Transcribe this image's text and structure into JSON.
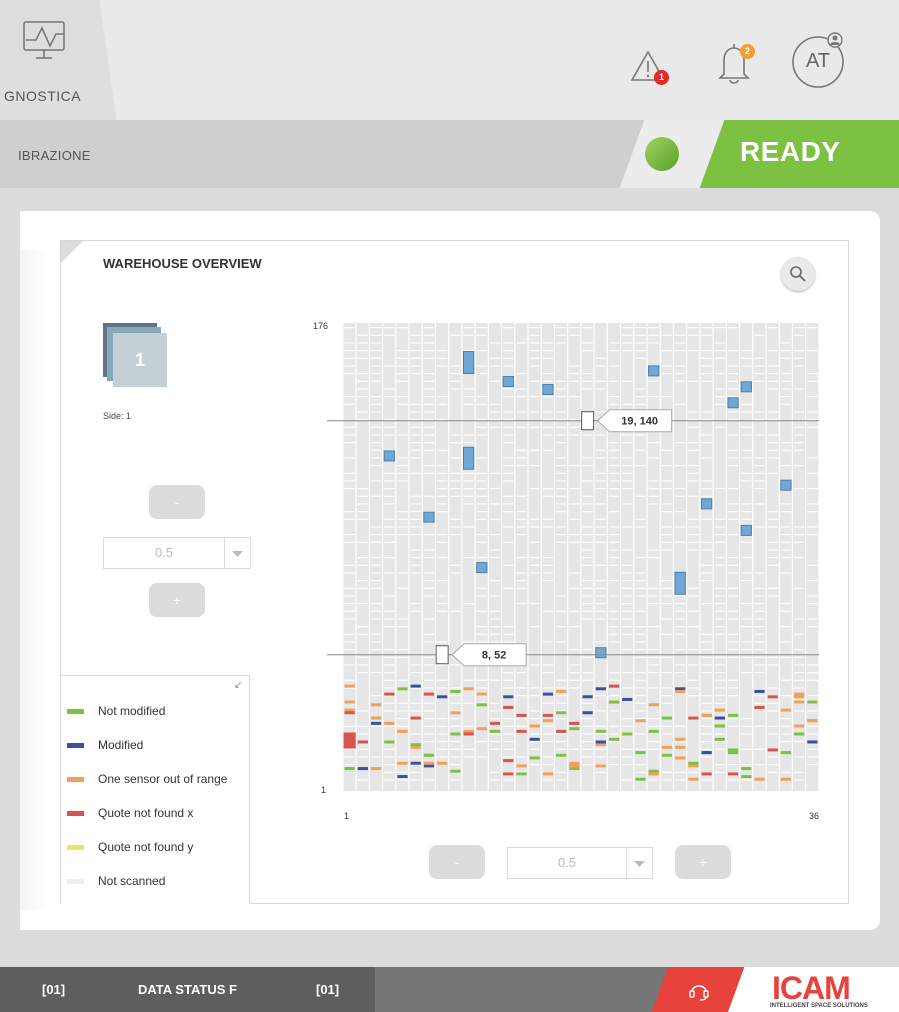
{
  "topbar": {
    "diagnostics_label": "GNOSTICA",
    "alerts_count": "1",
    "notifications_count": "2",
    "user_initials": "AT"
  },
  "subbar": {
    "label": "IBRAZIONE",
    "status": "READY"
  },
  "panel": {
    "title": "WAREHOUSE OVERVIEW",
    "side_number": "1",
    "side_label": "Side: 1",
    "left_zoom": {
      "minus": "-",
      "value": "0.5",
      "plus": "+"
    },
    "bottom_zoom": {
      "minus": "-",
      "value": "0.5",
      "plus": "+"
    }
  },
  "legend": {
    "items": [
      {
        "label": "Not modified",
        "color": "#7dc143"
      },
      {
        "label": "Modified",
        "color": "#3b4fa3"
      },
      {
        "label": "One sensor out of range",
        "color": "#f0a05a"
      },
      {
        "label": "Quote not found x",
        "color": "#d9534f"
      },
      {
        "label": "Quote not found y",
        "color": "#e8e85a"
      },
      {
        "label": "Not scanned",
        "color": "#eeeeee"
      }
    ]
  },
  "chart_data": {
    "type": "heatmap",
    "x_min_label": "1",
    "x_max_label": "36",
    "y_min_label": "1",
    "y_max_label": "176",
    "xlim": [
      1,
      36
    ],
    "ylim": [
      1,
      176
    ],
    "crosshairs": [
      {
        "x": 19,
        "y": 140,
        "label": "19, 140"
      },
      {
        "x": 8,
        "y": 52,
        "label": "8, 52"
      }
    ],
    "blue_cells": [
      [
        10,
        160
      ],
      [
        10,
        124
      ],
      [
        13,
        154
      ],
      [
        16,
        151
      ],
      [
        24,
        158
      ],
      [
        30,
        146
      ],
      [
        31,
        152
      ],
      [
        4,
        126
      ],
      [
        7,
        103
      ],
      [
        11,
        84
      ],
      [
        20,
        52
      ],
      [
        26,
        77
      ],
      [
        28,
        108
      ],
      [
        31,
        98
      ],
      [
        34,
        115
      ]
    ],
    "colors": {
      "blue": "#6fa8d6",
      "green": "#7dc143",
      "navy": "#3b4fa3",
      "orange": "#f0a05a",
      "red": "#d9534f",
      "grid": "#e6e6e6"
    }
  },
  "bottombar": {
    "seg1": "[01]",
    "seg2": "DATA STATUS F",
    "seg3": "[01]",
    "logo": "ICAM",
    "logo_sub": "INTELLIGENT SPACE SOLUTIONS"
  }
}
